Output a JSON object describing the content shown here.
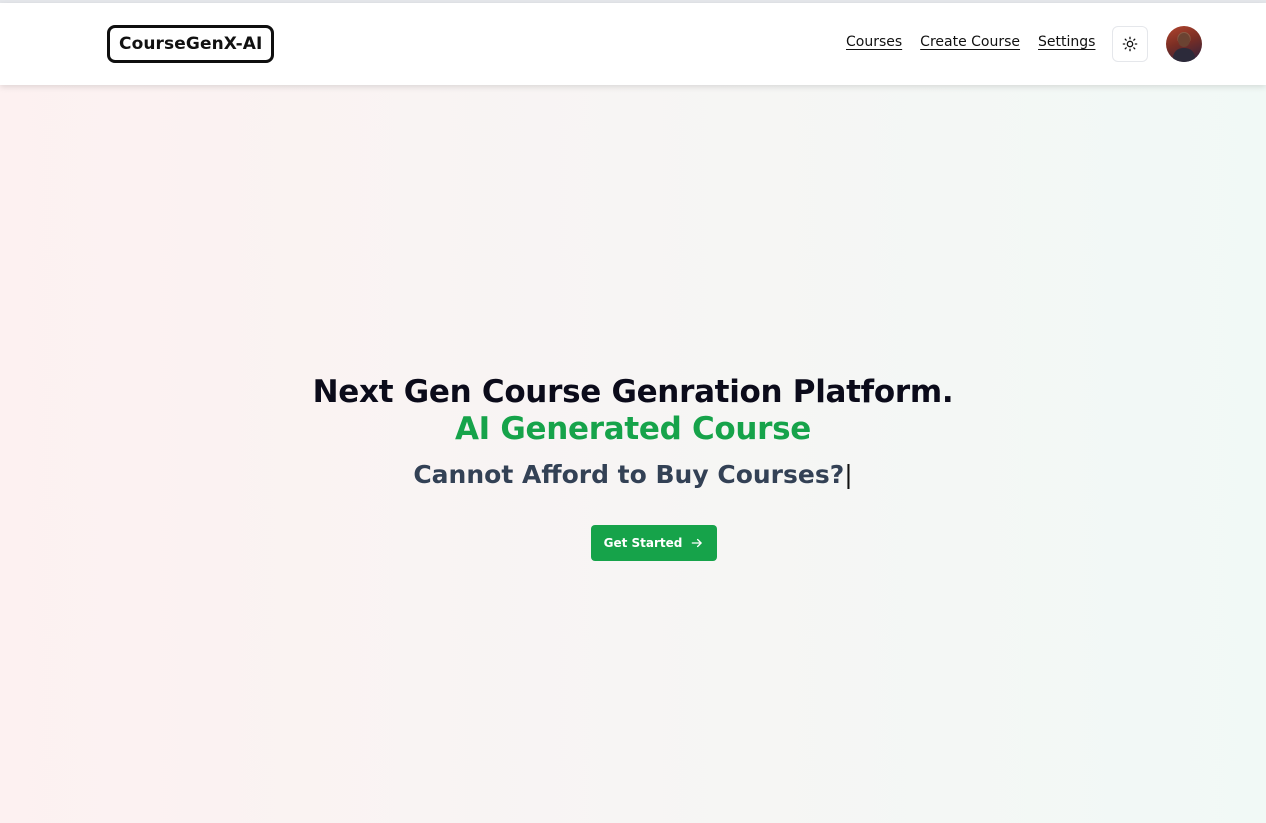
{
  "nav": {
    "logo": "CourseGenX-AI",
    "links": [
      "Courses",
      "Create Course",
      "Settings"
    ],
    "theme_icon": "sun-icon",
    "avatar_icon": "user-avatar"
  },
  "hero": {
    "headline": "Next Gen Course Genration Platform.",
    "subheadline": "AI Generated Course",
    "typing_text": "Cannot Afford to Buy Courses?",
    "cursor": "|",
    "cta_label": "Get Started",
    "cta_icon": "arrow-right-icon"
  },
  "colors": {
    "accent": "#16a34a",
    "headline": "#0b0b1a",
    "subtext": "#334155"
  }
}
